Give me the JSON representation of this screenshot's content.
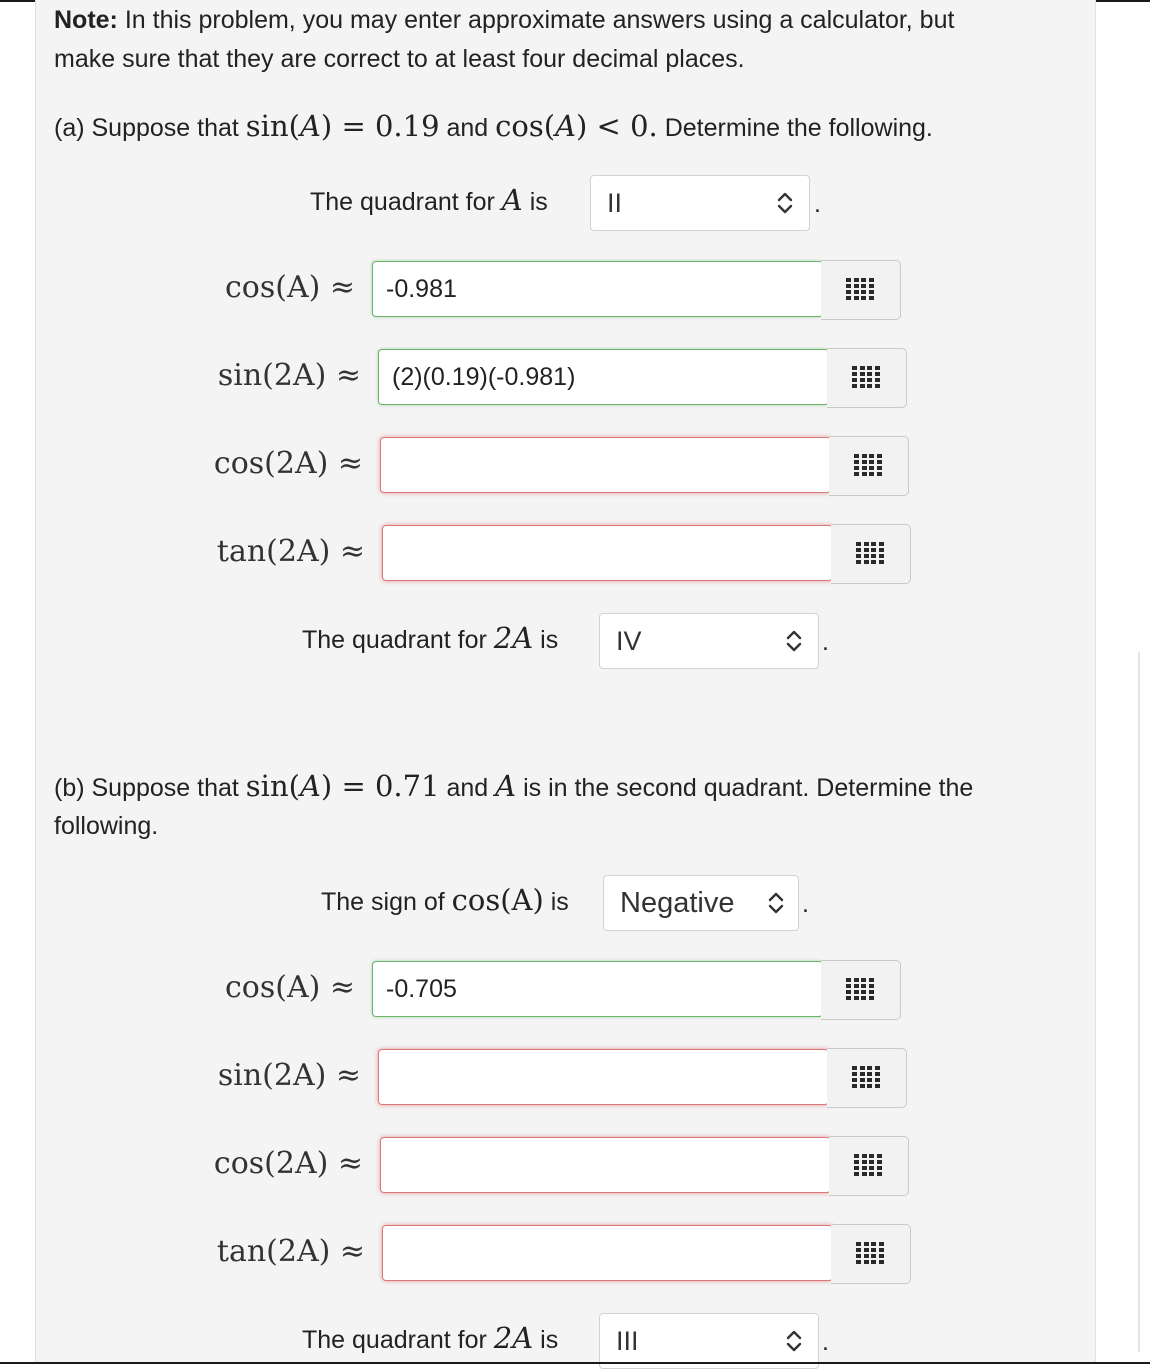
{
  "note": {
    "label": "Note:",
    "line1": "In this problem, you may enter approximate answers using a calculator, but",
    "line2": "make sure that they are correct to at least four decimal places."
  },
  "part_a": {
    "prefix": "(a) Suppose that",
    "sin_expr": "sin(",
    "var": "A",
    "sin_value": ") = 0.19",
    "and": "and",
    "cos_expr": "cos(",
    "cos_cond": ") < 0.",
    "suffix": "Determine the following.",
    "quadrant_label": "The quadrant for",
    "quadrant_var": "A",
    "is": "is",
    "quadrant_value": "II",
    "cos_A_value": "-0.981",
    "sin_2A_value": "(2)(0.19)(-0.981)",
    "cos_2A_value": "",
    "tan_2A_value": "",
    "quadrant2_label": "The quadrant for",
    "quadrant2_var": "2A",
    "quadrant2_value": "IV"
  },
  "part_b": {
    "prefix": "(b) Suppose that",
    "sin_expr": "sin(",
    "var": "A",
    "sin_value": ") = 0.71",
    "and": "and",
    "mid": "is in the second quadrant. Determine the",
    "line2": "following.",
    "sign_label": "The sign of",
    "sign_expr": "cos(A)",
    "is": "is",
    "sign_value": "Negative",
    "cos_A_value": "-0.705",
    "sin_2A_value": "",
    "cos_2A_value": "",
    "tan_2A_value": "",
    "quadrant_label": "The quadrant for",
    "quadrant_var": "2A",
    "quadrant_value": "III"
  },
  "labels": {
    "cos_A": "cos(A) ≈",
    "sin_2A": "sin(2A) ≈",
    "cos_2A": "cos(2A) ≈",
    "tan_2A": "tan(2A) ≈"
  },
  "icons": {
    "palette": "keypad-grid-icon",
    "select": "up-down-chevron-icon"
  },
  "colors": {
    "correct_border": "#6ab56a",
    "incorrect_border": "#d87a7a",
    "panel_bg": "#f4f4f4"
  }
}
